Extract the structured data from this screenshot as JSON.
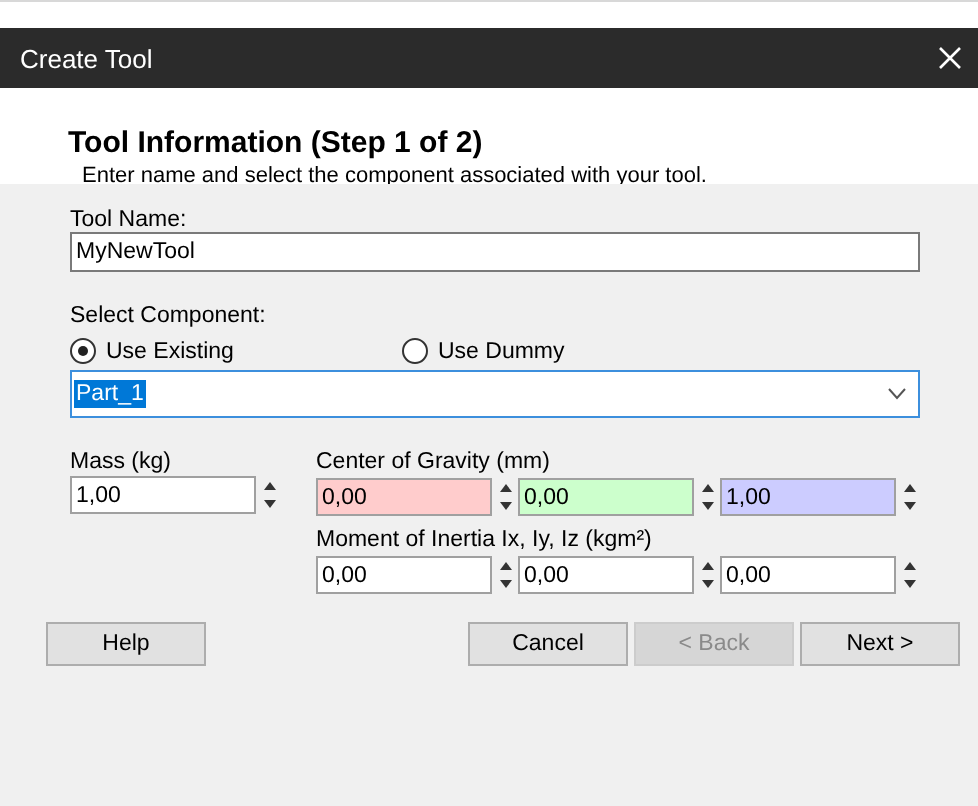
{
  "window": {
    "title": "Create Tool"
  },
  "header": {
    "title": "Tool Information (Step 1 of 2)",
    "subtitle": "Enter name and select the component associated with your tool."
  },
  "tool_name": {
    "label": "Tool Name:",
    "value": "MyNewTool"
  },
  "component": {
    "label": "Select Component:",
    "options": [
      {
        "label": "Use Existing",
        "selected": true
      },
      {
        "label": "Use Dummy",
        "selected": false
      }
    ],
    "dropdown": {
      "value": "Part_1",
      "text_selected": true
    }
  },
  "mass": {
    "label": "Mass (kg)",
    "value": "1,00"
  },
  "center_of_gravity": {
    "label": "Center of Gravity (mm)",
    "fields": [
      {
        "value": "0,00",
        "color": "#ffcccc"
      },
      {
        "value": "0,00",
        "color": "#ccffcc"
      },
      {
        "value": "1,00",
        "color": "#ccccff"
      }
    ]
  },
  "moment_of_inertia": {
    "label": "Moment of Inertia Ix, Iy, Iz (kgm²)",
    "fields": [
      {
        "value": "0,00"
      },
      {
        "value": "0,00"
      },
      {
        "value": "0,00"
      }
    ]
  },
  "buttons": [
    {
      "label": "Help",
      "disabled": false
    },
    {
      "label": "Cancel",
      "disabled": false
    },
    {
      "label": "< Back",
      "disabled": true
    },
    {
      "label": "Next >",
      "disabled": false
    }
  ]
}
